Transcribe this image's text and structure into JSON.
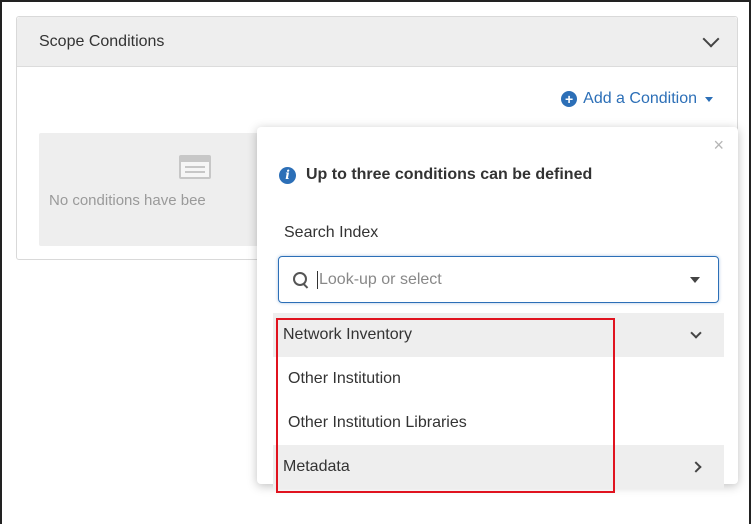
{
  "panel": {
    "title": "Scope Conditions",
    "add_condition_label": "Add a Condition",
    "empty_text": "No conditions have bee"
  },
  "popover": {
    "close_glyph": "×",
    "info_text": "Up to three conditions can be defined",
    "field_label": "Search Index",
    "search_placeholder": "Look-up or select",
    "options": {
      "group_network": "Network Inventory",
      "item_other_institution": "Other Institution",
      "item_other_institution_libraries": "Other Institution Libraries",
      "group_metadata": "Metadata"
    }
  },
  "icons": {
    "collapse": "chevron-down-icon",
    "add": "plus-circle-icon",
    "info": "info-icon",
    "search": "search-icon",
    "empty": "list-icon"
  },
  "colors": {
    "accent": "#2c6fb7",
    "highlight": "#e0131f",
    "header_bg": "#eeeeee"
  }
}
